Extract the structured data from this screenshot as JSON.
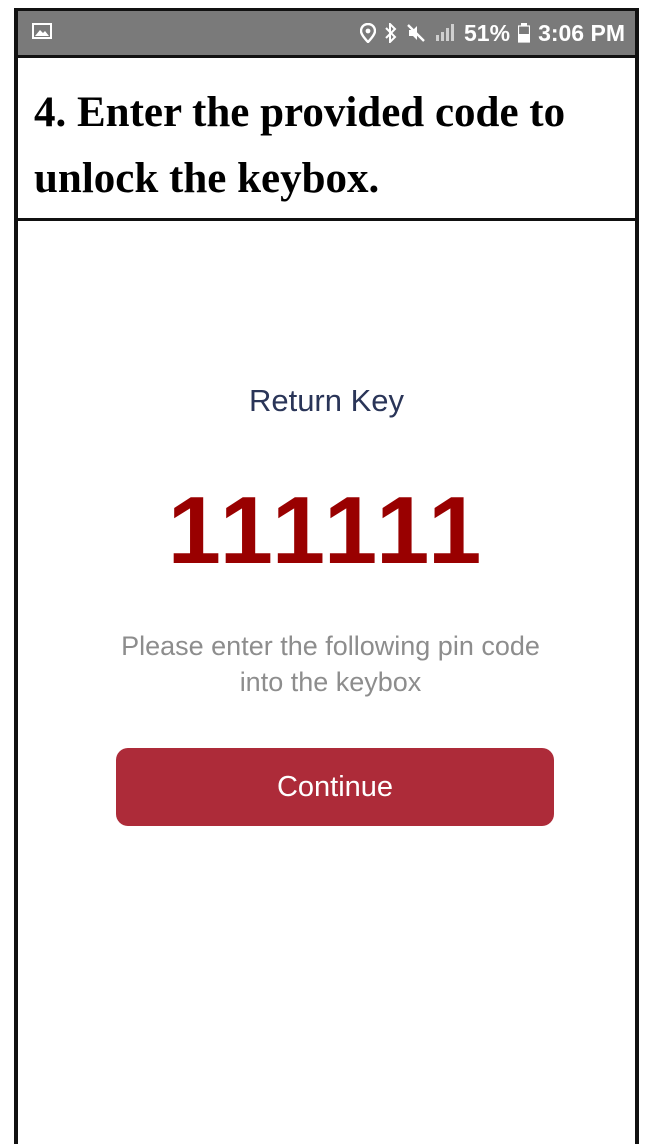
{
  "status_bar": {
    "battery_percent": "51%",
    "time": "3:06 PM",
    "icons": [
      "image-icon",
      "location-icon",
      "bluetooth-icon",
      "mute-icon",
      "signal-icon",
      "battery-icon"
    ]
  },
  "instruction": {
    "text": "4. Enter the provided code to unlock the keybox."
  },
  "screen": {
    "title": "Return Key",
    "pin_code": "111111",
    "message": "Please enter the following pin code into the keybox",
    "continue_label": "Continue"
  },
  "colors": {
    "status_bar": "#7a7a7a",
    "title": "#2a3558",
    "pin": "#990000",
    "message": "#8d8d8d",
    "button": "#ad2b39"
  }
}
